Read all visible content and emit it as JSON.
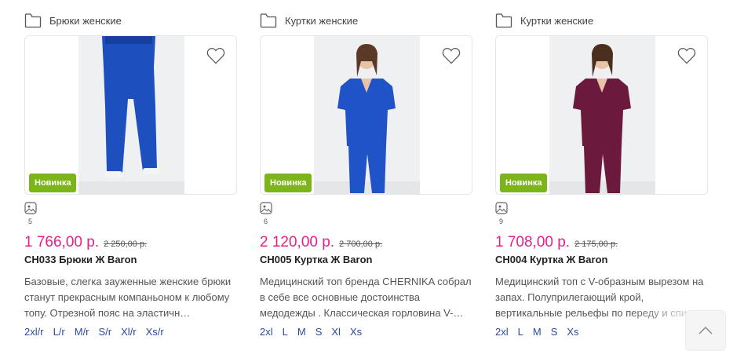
{
  "products": [
    {
      "category": "Брюки женские",
      "badge": "Новинка",
      "photos_count": "5",
      "price": "1 766,00 р.",
      "old_price": "2 250,00 р.",
      "title": "CH033 Брюки Ж Baron",
      "description": "Базовые, слегка зауженные женские брюки станут прекрасным компаньоном к любому топу. Отрезной пояс на эластичн…",
      "sizes": [
        "2xl/r",
        "L/r",
        "M/r",
        "S/r",
        "Xl/r",
        "Xs/r"
      ],
      "garment_color": "#1e4fbf"
    },
    {
      "category": "Куртки женские",
      "badge": "Новинка",
      "photos_count": "6",
      "price": "2 120,00 р.",
      "old_price": "2 700,00 р.",
      "title": "CH005 Куртка Ж Baron",
      "description": "Медицинский топ бренда CHERNIKA собрал в себе все основные достоинства медодежды . Классическая горловина V-…",
      "sizes": [
        "2xl",
        "L",
        "M",
        "S",
        "Xl",
        "Xs"
      ],
      "garment_color": "#1f53c7"
    },
    {
      "category": "Куртки женские",
      "badge": "Новинка",
      "photos_count": "9",
      "price": "1 708,00 р.",
      "old_price": "2 175,00 р.",
      "title": "CH004 Куртка Ж Baron",
      "description": "Медицинский топ с V-образным вырезом на запах. Полуприлегающий крой, вертикальные рельефы по переду и спин…",
      "sizes": [
        "2xl",
        "L",
        "M",
        "S",
        "Xs"
      ],
      "garment_color": "#6b1a3e"
    }
  ],
  "colors": {
    "price": "#e91e8c",
    "badge": "#7cb518",
    "size_link": "#2a4a9a"
  },
  "icons": {
    "category": "folder-icon",
    "favorite": "heart-icon",
    "photos": "image-icon",
    "scroll": "chevron-up-icon"
  }
}
